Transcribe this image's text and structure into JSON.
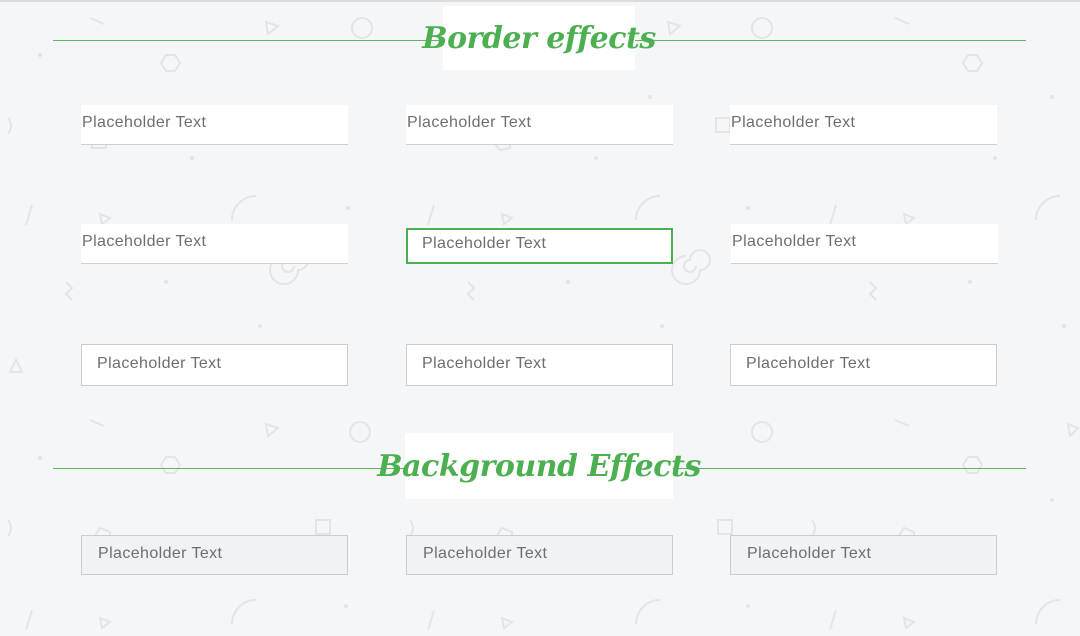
{
  "sections": [
    {
      "title": "Border effects"
    },
    {
      "title": "Background Effects"
    }
  ],
  "fields": [
    {
      "placeholder": "Placeholder Text"
    },
    {
      "placeholder": "Placeholder Text"
    },
    {
      "placeholder": "Placeholder Text"
    },
    {
      "placeholder": "Placeholder Text"
    },
    {
      "placeholder": "Placeholder Text"
    },
    {
      "placeholder": "Placeholder Text"
    },
    {
      "placeholder": "Placeholder Text"
    },
    {
      "placeholder": "Placeholder Text"
    },
    {
      "placeholder": "Placeholder Text"
    },
    {
      "placeholder": "Placeholder Text"
    },
    {
      "placeholder": "Placeholder Text"
    },
    {
      "placeholder": "Placeholder Text"
    }
  ],
  "colors": {
    "accent": "#4caf50",
    "page_background": "#f5f6f8",
    "field_border": "#cccccc"
  }
}
